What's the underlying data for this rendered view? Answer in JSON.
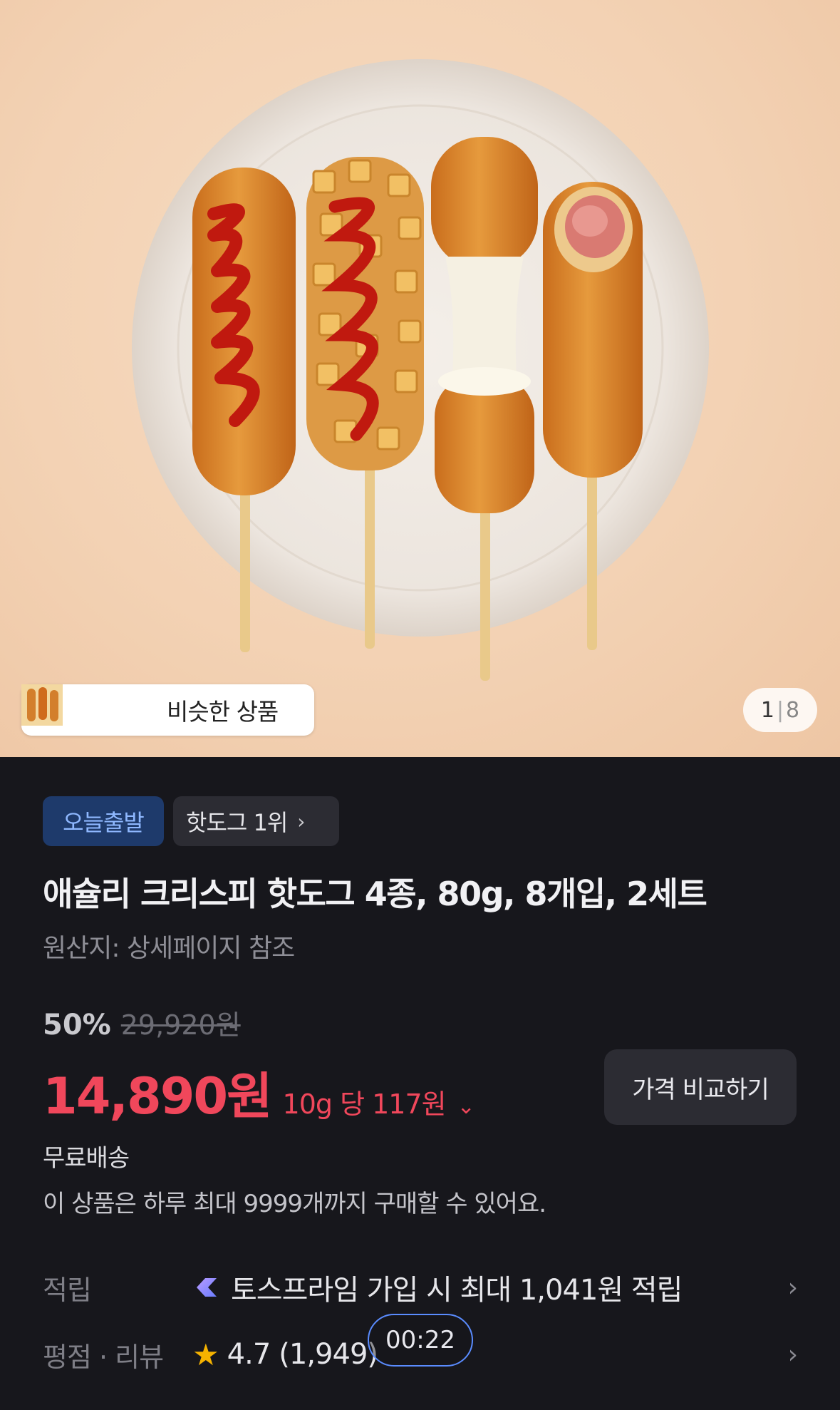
{
  "gallery": {
    "similar_label": "비슷한 상품",
    "current_page": "1",
    "total_pages": "8"
  },
  "tags": {
    "today": "오늘출발",
    "rank": "핫도그 1위"
  },
  "product": {
    "title": "애슐리 크리스피 핫도그 4종, 80g, 8개입, 2세트",
    "origin": "원산지: 상세페이지 참조",
    "discount": "50%",
    "original_price": "29,920원",
    "price": "14,890원",
    "unit_price": "10g 당 117원",
    "compare_label": "가격 비교하기",
    "shipping": "무료배송",
    "limit": "이 상품은 하루 최대 9999개까지 구매할 수 있어요."
  },
  "points": {
    "label": "적립",
    "value": "토스프라임 가입 시 최대 1,041원 적립"
  },
  "reviews": {
    "label": "평점 · 리뷰",
    "rating": "4.7",
    "count": "(1,949)"
  },
  "overlay": {
    "timer": "00:22"
  },
  "colors": {
    "accent_price": "#f0475b",
    "tag_blue_bg": "#1e3a6b",
    "tag_blue_text": "#8fb8ff",
    "background": "#17171c",
    "star": "#f6b300"
  }
}
